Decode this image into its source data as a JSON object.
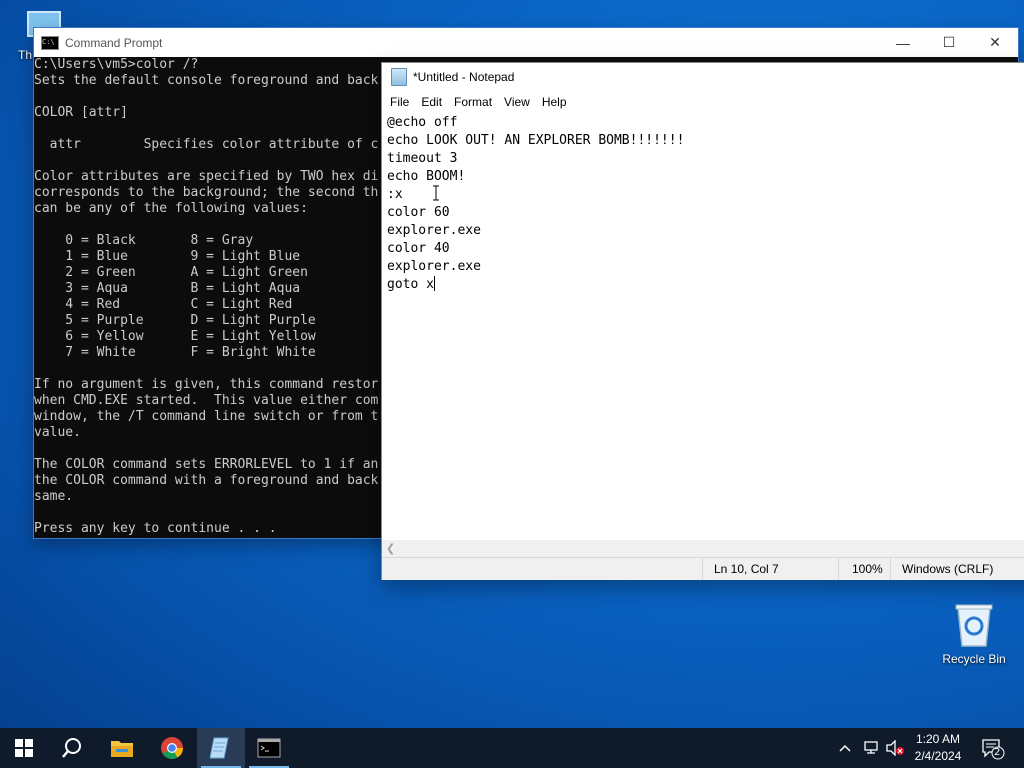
{
  "desktop": {
    "thispc_label": "Th",
    "recycle_label": "Recycle Bin"
  },
  "cmd": {
    "title": "Command Prompt",
    "lines": [
      "C:\\Users\\vm5>color /?",
      "Sets the default console foreground and back",
      "",
      "COLOR [attr]",
      "",
      "  attr        Specifies color attribute of c",
      "",
      "Color attributes are specified by TWO hex di",
      "corresponds to the background; the second th",
      "can be any of the following values:",
      "",
      "    0 = Black       8 = Gray",
      "    1 = Blue        9 = Light Blue",
      "    2 = Green       A = Light Green",
      "    3 = Aqua        B = Light Aqua",
      "    4 = Red         C = Light Red",
      "    5 = Purple      D = Light Purple",
      "    6 = Yellow      E = Light Yellow",
      "    7 = White       F = Bright White",
      "",
      "If no argument is given, this command restor",
      "when CMD.EXE started.  This value either com",
      "window, the /T command line switch or from t",
      "value.",
      "",
      "The COLOR command sets ERRORLEVEL to 1 if an",
      "the COLOR command with a foreground and back",
      "same.",
      "",
      "Press any key to continue . . ."
    ]
  },
  "notepad": {
    "title": "*Untitled - Notepad",
    "menu": [
      "File",
      "Edit",
      "Format",
      "View",
      "Help"
    ],
    "lines": [
      "@echo off",
      "echo LOOK OUT! AN EXPLORER BOMB!!!!!!!",
      "timeout 3",
      "echo BOOM!",
      ":x",
      "color 60",
      "explorer.exe",
      "color 40",
      "explorer.exe",
      "goto x"
    ],
    "status": {
      "position": "Ln 10, Col 7",
      "zoom": "100%",
      "line_ending": "Windows (CRLF)"
    }
  },
  "taskbar": {
    "icons": [
      "windows-start-icon",
      "search-icon",
      "file-explorer-icon",
      "chrome-icon",
      "notepad-icon",
      "command-prompt-icon"
    ],
    "time": "1:20 AM",
    "date": "2/4/2024",
    "notification_count": "2"
  }
}
